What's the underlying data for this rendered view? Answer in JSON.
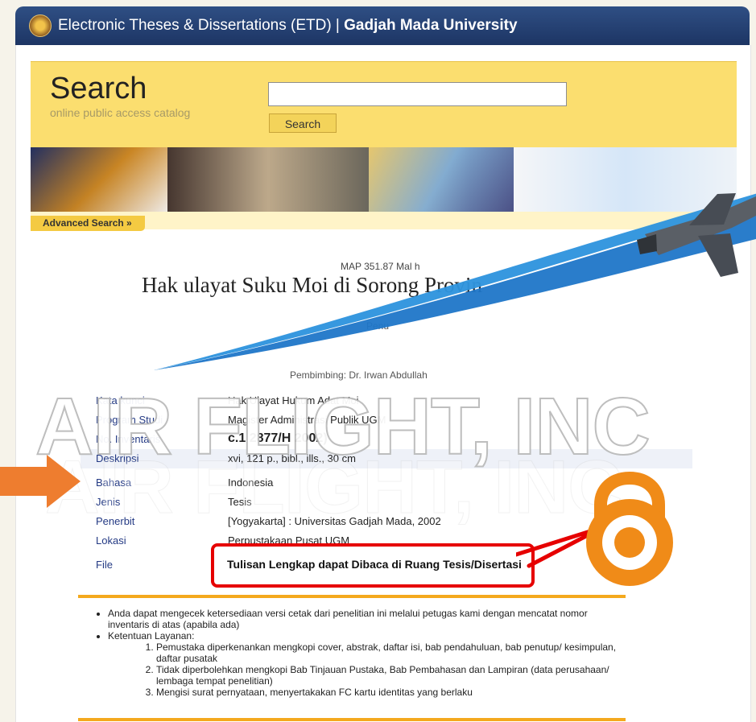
{
  "header": {
    "title_prefix": "Electronic Theses & Dissertations (ETD) | ",
    "title_bold": "Gadjah Mada University"
  },
  "search": {
    "heading": "Search",
    "subheading": "online public access catalog",
    "input_value": "",
    "button_label": "Search",
    "advanced_label": "Advanced Search »"
  },
  "record": {
    "call_number": "MAP 351.87 Mal h",
    "title": "Hak ulayat Suku Moi di Sorong Provin",
    "author_fragment": "Penu",
    "supervisor_fragment": "Pembimbing: Dr. Irwan Abdullah",
    "rows": [
      {
        "label": "Kata kunci",
        "value": "Hak Ulayat Hukum Adat Moi"
      },
      {
        "label": "Program Studi",
        "value": "Magister Administrasi Publik UGM"
      },
      {
        "label": "No. Inventaris",
        "value": "c.1 2877/H 2002)"
      },
      {
        "label": "Deskripsi",
        "value": "xvi, 121 p., bibl., ills., 30 cm"
      },
      {
        "label": "Bahasa",
        "value": "Indonesia"
      },
      {
        "label": "Jenis",
        "value": "Tesis"
      },
      {
        "label": "Penerbit",
        "value": "[Yogyakarta] : Universitas Gadjah Mada, 2002"
      },
      {
        "label": "Lokasi",
        "value": "Perpustakaan Pusat UGM"
      },
      {
        "label": "File",
        "value": "Tulisan Lengkap dapat Dibaca di Ruang Tesis/Disertasi"
      }
    ]
  },
  "notes": {
    "bullet1": "Anda dapat mengecek ketersediaan versi cetak dari penelitian ini melalui petugas kami dengan mencatat nomor inventaris di atas (apabila ada)",
    "bullet2": "Ketentuan Layanan:",
    "steps": [
      "Pemustaka diperkenankan mengkopi cover, abstrak, daftar isi, bab pendahuluan, bab penutup/ kesimpulan, daftar pusatak",
      "Tidak diperbolehkan mengkopi Bab Tinjauan Pustaka, Bab Pembahasan dan Lampiran (data perusahaan/ lembaga tempat penelitian)",
      "Mengisi surat pernyataan, menyertakakan FC kartu identitas yang berlaku"
    ]
  },
  "watermark": {
    "text": "AIR FLIGHT, INC"
  },
  "colors": {
    "header": "#2f4f84",
    "search_band": "#fbde6f",
    "label_blue": "#243a84",
    "callout_red": "#e60000",
    "accent_orange": "#f4a91d"
  }
}
